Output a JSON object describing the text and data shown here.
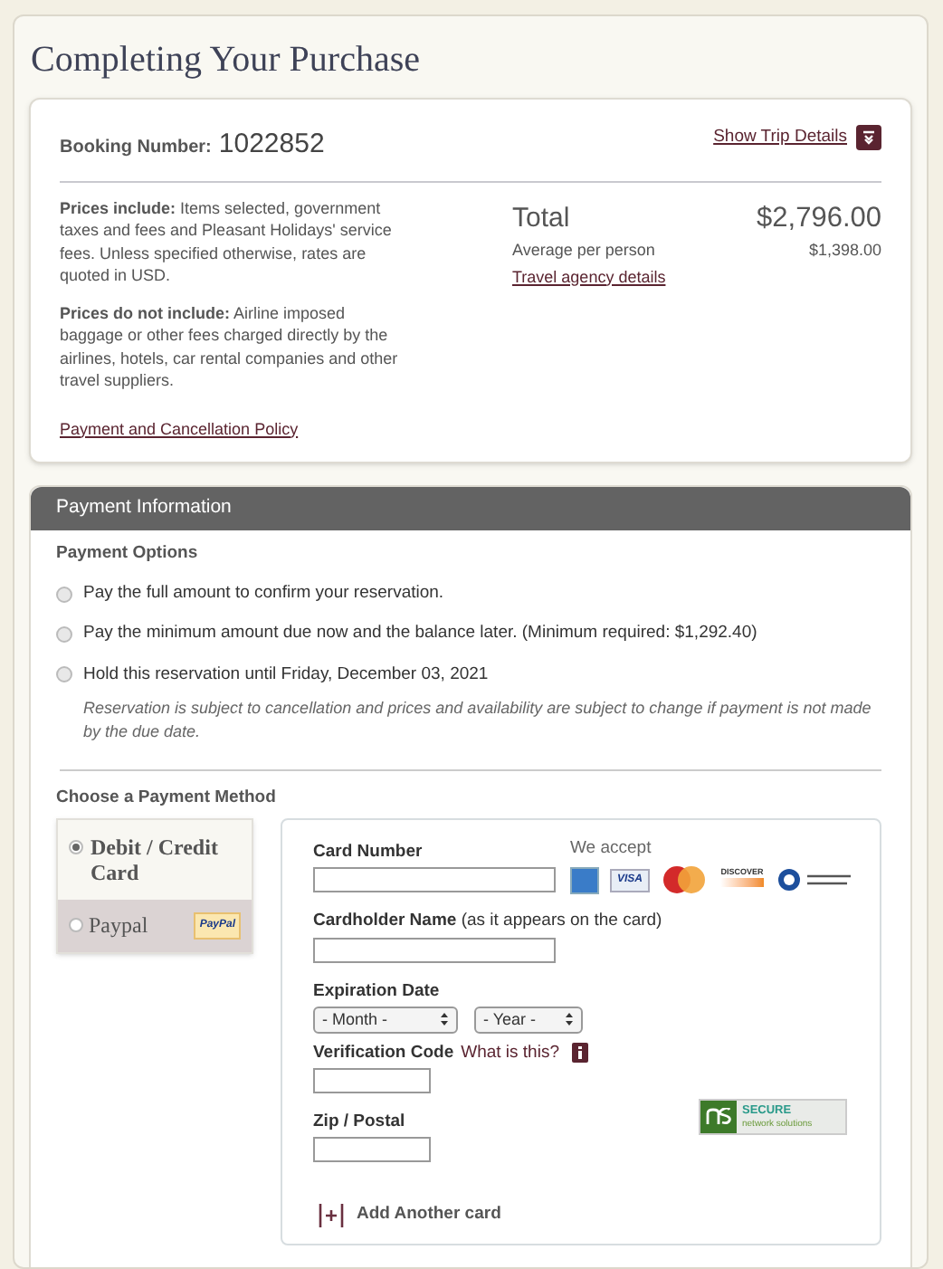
{
  "page_title": "Completing Your Purchase",
  "summary": {
    "booking_label": "Booking Number:",
    "booking_number": "1022852",
    "details_link": "Show Trip Details",
    "includes": "**Prices include:** Items selected, government taxes and fees and Pleasant Holidays' service fees. Unless specified otherwise, rates are quoted in USD.",
    "excludes": "**Prices do not include:** Airline imposed baggage or other fees charged directly by the airlines, hotels, car rental companies and other travel suppliers.",
    "policy_link": "Payment and Cancellation Policy",
    "total_label": "Total",
    "total": "$2,796.00",
    "average_label": "Average per person",
    "average": "$1,398.00",
    "agency_link": "Travel agency details"
  },
  "payment": {
    "header": "Payment Information",
    "options_title": "Payment Options",
    "options": [
      {
        "label": "Pay the full amount to confirm your reservation.",
        "selected": false
      },
      {
        "label": "Pay the minimum amount due now and the balance later. (Minimum required: $1,292.40)",
        "selected": false
      },
      {
        "label": "Hold this reservation until Friday, December 03, 2021",
        "selected": false
      }
    ],
    "note": "Reservation is subject to cancellation and prices and availability are subject to change if payment is not made by the due date.",
    "method_title": "Choose a Payment Method",
    "methods": [
      {
        "label": "Debit / Credit Card",
        "selected": true
      },
      {
        "label": "Paypal",
        "selected": false,
        "badge": "PayPal"
      }
    ],
    "accept_label": "We accept",
    "cards": [
      {
        "kind": "amex"
      },
      {
        "kind": "visa",
        "text": "VISA"
      },
      {
        "kind": "mastercard"
      },
      {
        "kind": "discover",
        "text": "DISCOVER"
      },
      {
        "kind": "diners"
      }
    ],
    "fields": [
      {
        "kind": "text",
        "label": "**Card Number**"
      },
      {
        "kind": "text",
        "label": "**Cardholder Name** (as it appears on the card)"
      },
      {
        "kind": "selects",
        "label": "**Expiration Date**",
        "options": [
          "- Month -",
          "- Year -"
        ]
      },
      {
        "kind": "code",
        "label": "**Verification Code**",
        "link": "What is this?"
      },
      {
        "kind": "code",
        "label": "**Zip / Postal**"
      }
    ],
    "secure_badge": {
      "title": "SECURE",
      "subtitle": "network solutions"
    },
    "add_card": "Add Another card"
  }
}
